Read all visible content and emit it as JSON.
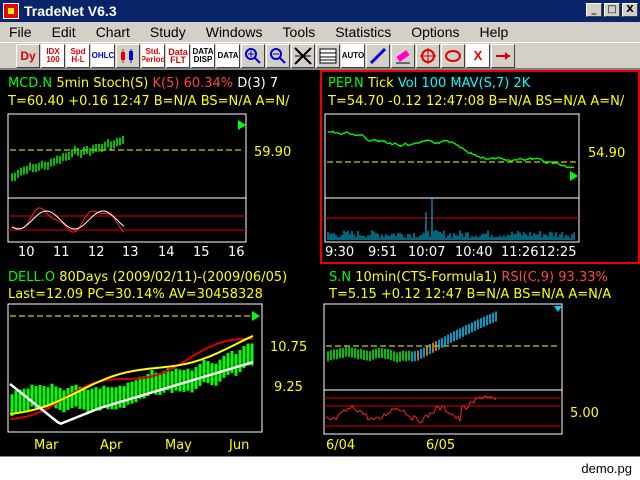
{
  "window": {
    "title": "TradeNet V6.3",
    "min": "_",
    "max": "□",
    "close": "X"
  },
  "menu": [
    "File",
    "Edit",
    "Chart",
    "Study",
    "Windows",
    "Tools",
    "Statistics",
    "Options",
    "Help"
  ],
  "toolbar": {
    "dy": "Dy",
    "idx": "IDX 100",
    "spd": "Spd H-L",
    "ohlc": "OHLC",
    "std": "Std. Period",
    "data_flt": "Data FLT",
    "data_disp": "DATA DISP",
    "data_grid": "DATA",
    "auto": "AUTO",
    "x": "X"
  },
  "panels": {
    "mcd": {
      "symbol": "MCD.N",
      "period": "5min",
      "study": "Stoch(S)",
      "k": "K(5)",
      "kval": "60.34%",
      "d": "D(3)",
      "dval": "7",
      "quote": "T=60.40  +0.16  12:47  B=N/A  BS=N/A  A=N/",
      "price": "59.90",
      "x_labels": [
        "10",
        "11",
        "12",
        "13",
        "14",
        "15",
        "16"
      ]
    },
    "pep": {
      "symbol": "PEP.N",
      "period": "Tick",
      "study": "Vol  100  MAV(S,7)  2K",
      "quote": "T=54.70  -0.12  12:47:08  B=N/A  BS=N/A  A=N/",
      "price": "54.90",
      "x_labels": [
        "9:30",
        "9:51",
        "10:07",
        "10:40",
        "11:26",
        "12:25"
      ]
    },
    "dell": {
      "symbol": "DELL.O",
      "period": "80Days",
      "range": "(2009/02/11)-(2009/06/05)",
      "quote": "Last=12.09  PC=30.14%  AV=30458328",
      "prices": [
        "10.75",
        "9.25"
      ],
      "x_labels": [
        "Mar",
        "Apr",
        "May",
        "Jun"
      ]
    },
    "s": {
      "symbol": "S.N",
      "period": "10min(CTS-Formula1)",
      "study": "RSI(C,9)",
      "sval": "93.33%",
      "quote": "T=5.15  +0.12  12:47  B=N/A  BS=N/A  A=N/A",
      "price": "5.00",
      "x_labels": [
        "6/04",
        "6/05"
      ]
    }
  },
  "status": "demo.pg"
}
